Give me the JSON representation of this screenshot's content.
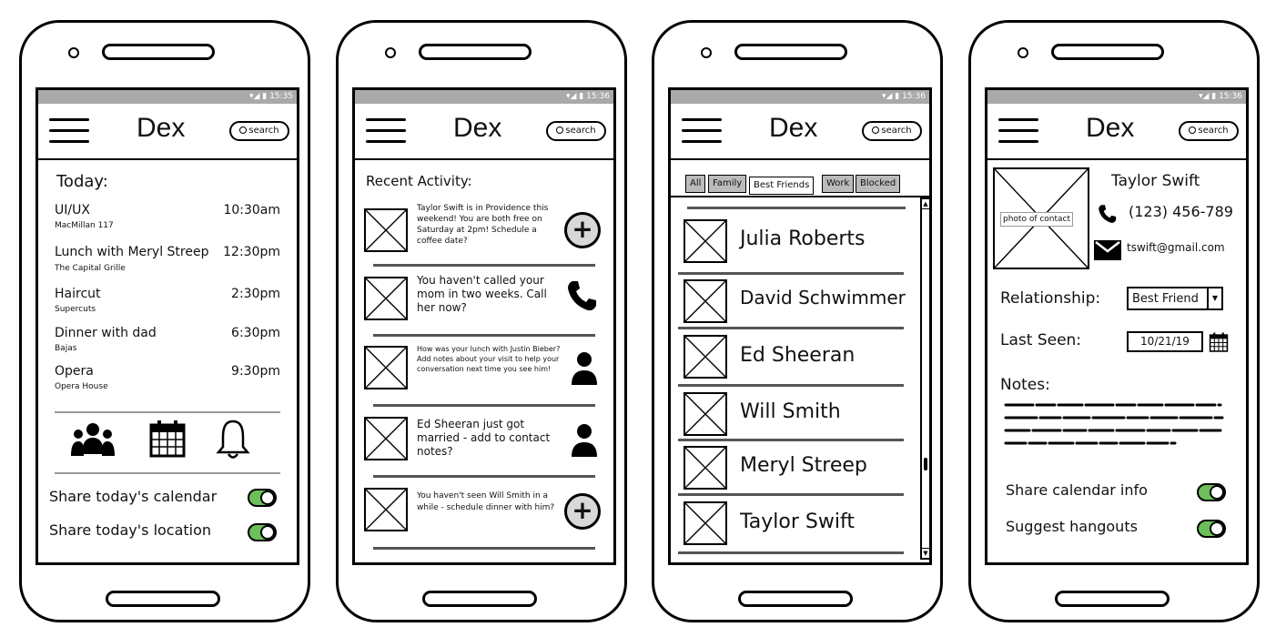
{
  "status_time": [
    "15:35",
    "15:36",
    "15:36",
    "15:36"
  ],
  "app_title": "Dex",
  "search_placeholder": "search",
  "screen1": {
    "heading": "Today:",
    "events": [
      {
        "title": "UI/UX",
        "location": "MacMillan 117",
        "time": "10:30am"
      },
      {
        "title": "Lunch with Meryl Streep",
        "location": "The Capital Grille",
        "time": "12:30pm"
      },
      {
        "title": "Haircut",
        "location": "Supercuts",
        "time": "2:30pm"
      },
      {
        "title": "Dinner with dad",
        "location": "Bajas",
        "time": "6:30pm"
      },
      {
        "title": "Opera",
        "location": "Opera House",
        "time": "9:30pm"
      }
    ],
    "toggles": [
      "Share today's calendar",
      "Share today's location"
    ]
  },
  "screen2": {
    "heading": "Recent Activity:",
    "items": [
      {
        "text": "Taylor Swift is in Providence this weekend! You are both free on Saturday at 2pm! Schedule a coffee date?",
        "icon": "plus-icon"
      },
      {
        "text": "You haven't called your mom in two weeks. Call her now?",
        "icon": "phone-icon"
      },
      {
        "text": "How was your lunch with Justin Bieber? Add notes about your visit to help your conversation next time you see him!",
        "icon": "person-icon"
      },
      {
        "text": "Ed Sheeran just got married - add to contact notes?",
        "icon": "person-icon"
      },
      {
        "text": "You haven't seen Will Smith in a while - schedule dinner with him?",
        "icon": "plus-icon"
      }
    ]
  },
  "screen3": {
    "tabs": [
      "All",
      "Family",
      "Best Friends",
      "Work",
      "Blocked"
    ],
    "active_tab": "Best Friends",
    "contacts": [
      "Julia Roberts",
      "David Schwimmer",
      "Ed Sheeran",
      "Will Smith",
      "Meryl Streep",
      "Taylor Swift"
    ]
  },
  "screen4": {
    "photo_label": "photo of contact",
    "name": "Taylor Swift",
    "phone": "(123) 456-789",
    "email": "tswift@gmail.com",
    "relationship_label": "Relationship:",
    "relationship_value": "Best Friend",
    "last_seen_label": "Last Seen:",
    "last_seen_value": "10/21/19",
    "notes_label": "Notes:",
    "toggles": [
      "Share calendar info",
      "Suggest hangouts"
    ]
  },
  "colors": {
    "toggle_on": "#6cbf5a",
    "statusbar": "#a9a9a9"
  }
}
